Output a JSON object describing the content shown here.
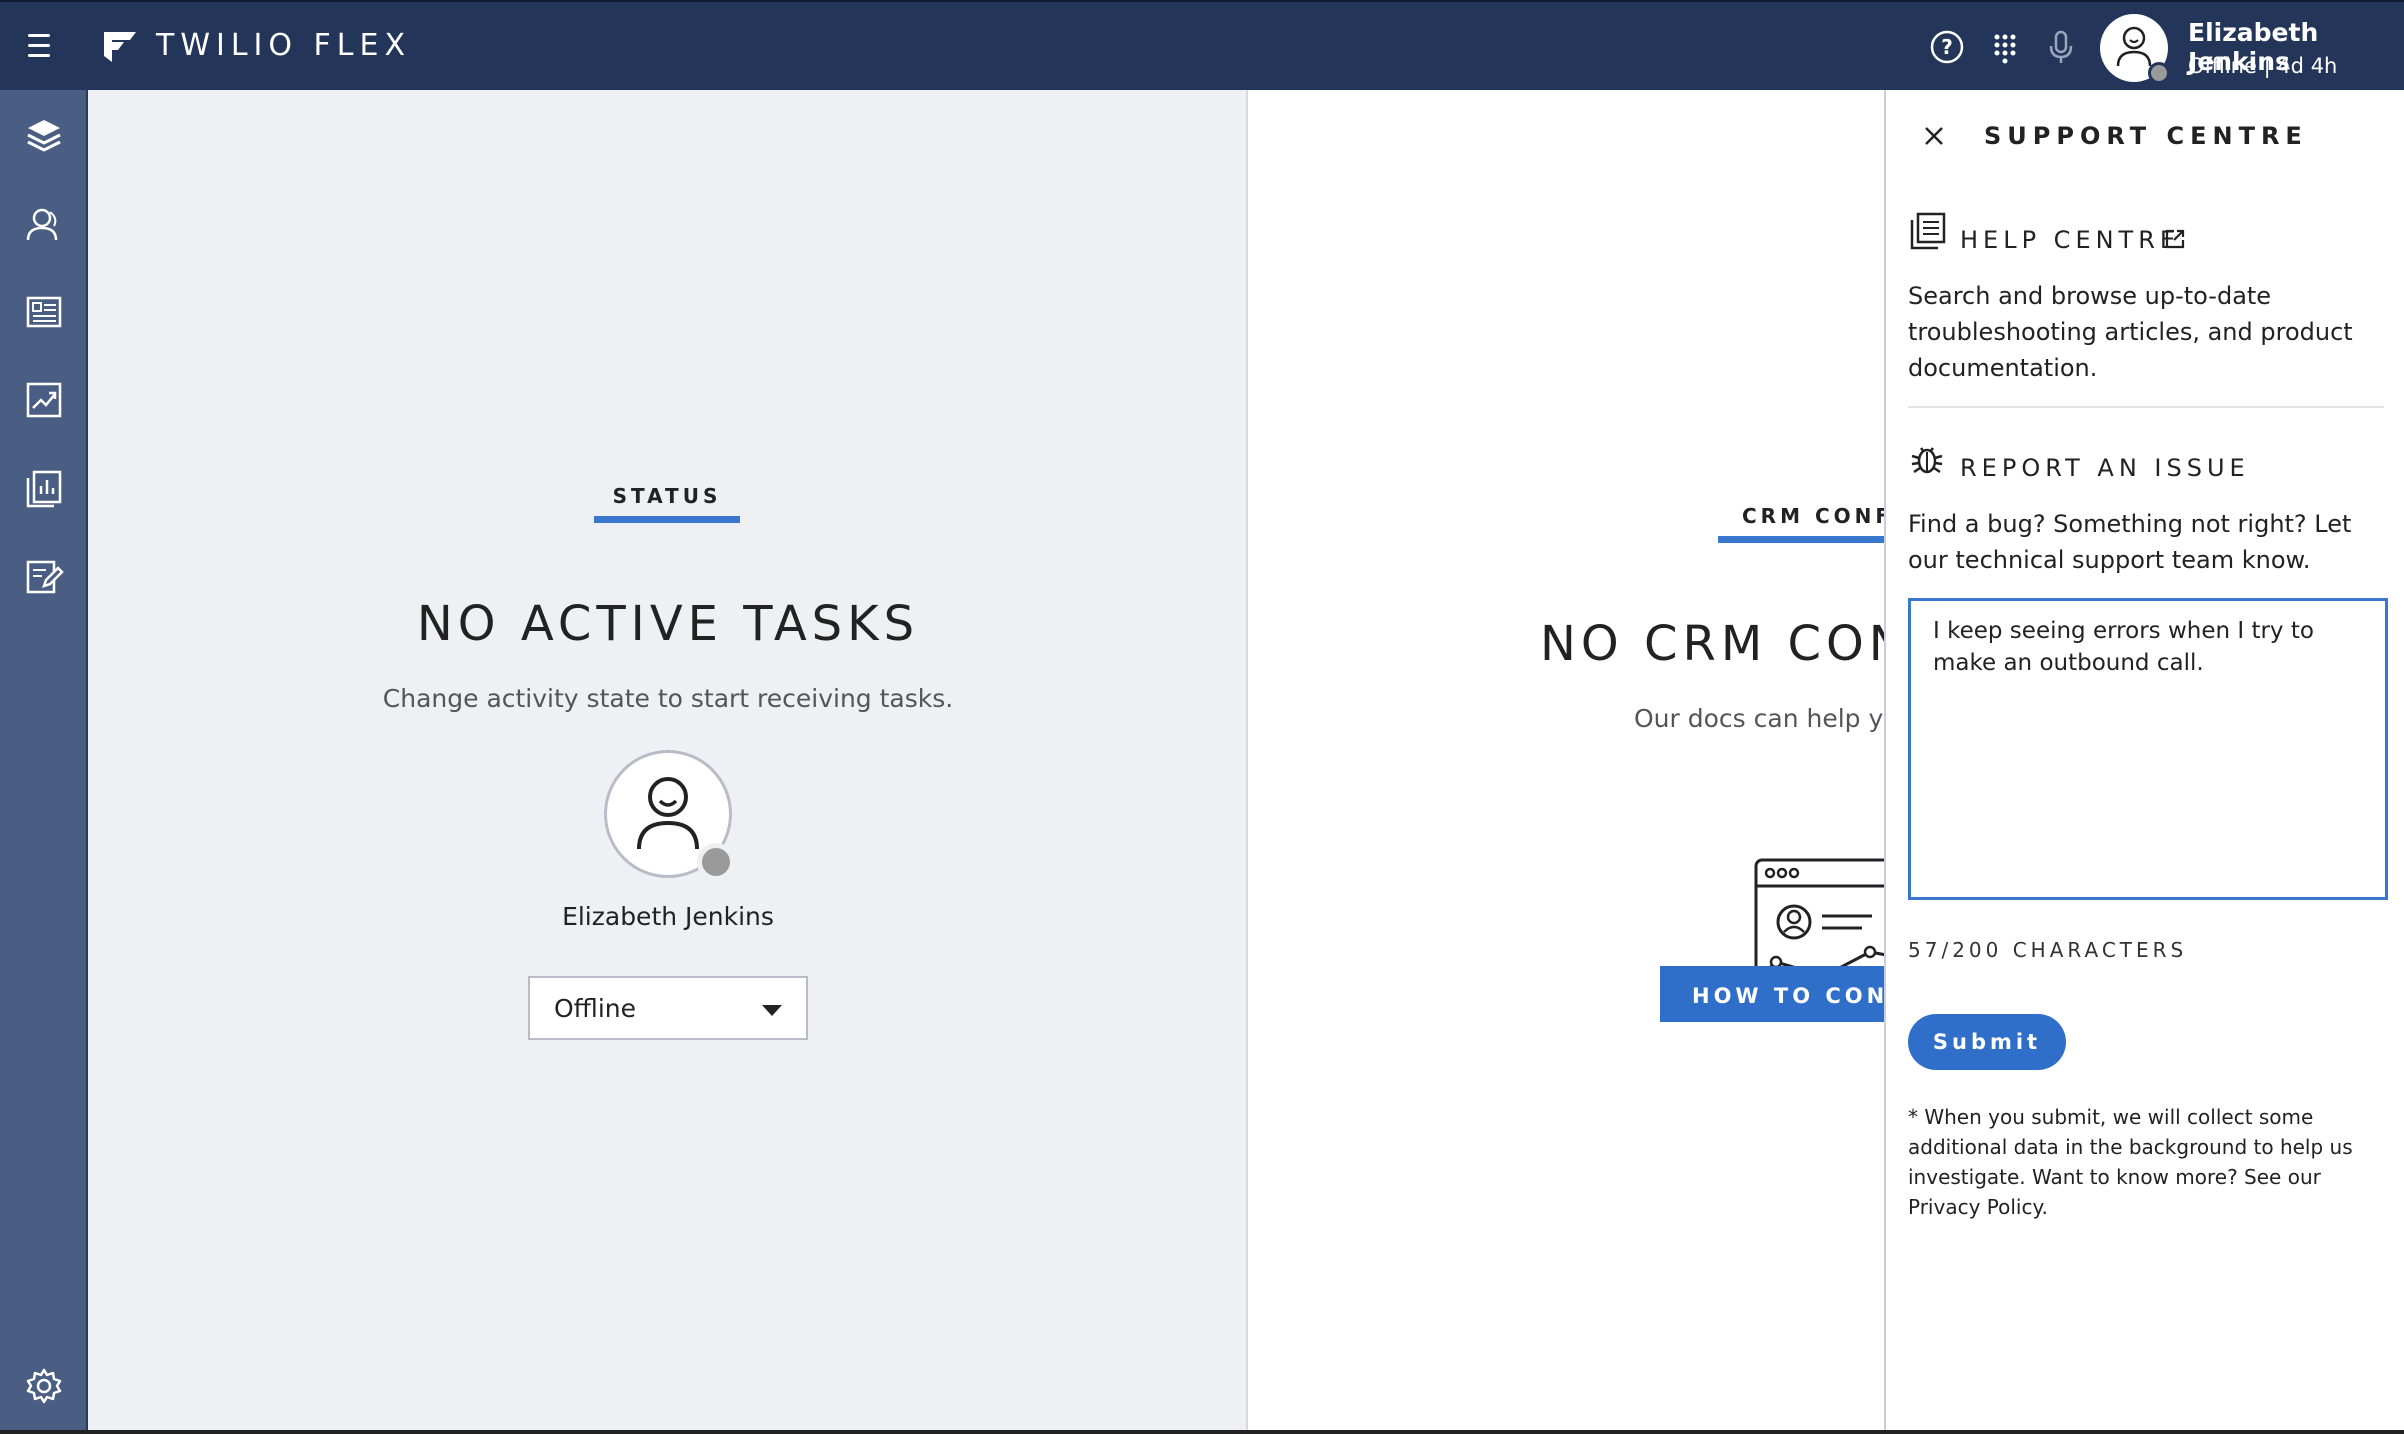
{
  "app": {
    "brand": "TWILIO FLEX"
  },
  "header": {
    "user_name": "Elizabeth Jenkins",
    "user_status": "Offline | 4d 4h",
    "icons": [
      "help-icon",
      "dialpad-icon",
      "microphone-icon"
    ]
  },
  "sidebar": {
    "items": [
      {
        "icon": "layers-icon"
      },
      {
        "icon": "agents-icon"
      },
      {
        "icon": "directory-icon"
      },
      {
        "icon": "analytics-icon"
      },
      {
        "icon": "reports-icon"
      },
      {
        "icon": "edit-icon"
      }
    ],
    "footer_icon": "settings-icon"
  },
  "status_panel": {
    "tab_label": "STATUS",
    "title": "NO ACTIVE TASKS",
    "subtitle": "Change activity state to start receiving tasks.",
    "agent_name": "Elizabeth Jenkins",
    "activity_value": "Offline"
  },
  "crm_panel": {
    "tab_label": "CRM CONFI",
    "title": "NO CRM CON",
    "subtitle": "Our docs can help you",
    "button_label": "HOW TO CONFI"
  },
  "support": {
    "title": "SUPPORT CENTRE",
    "help": {
      "title": "HELP CENTRE",
      "text": "Search and browse up-to-date troubleshooting articles, and product documentation."
    },
    "report": {
      "title": "REPORT AN ISSUE",
      "text": "Find a bug? Something not right? Let our technical support team know.",
      "message": "I keep seeing errors when I try to make an outbound call.",
      "char_count": "57/200 CHARACTERS",
      "submit_label": "Submit",
      "footnote": "* When you submit, we will collect some additional data in the background to help us investigate. Want to know more? See our Privacy Policy."
    }
  },
  "colors": {
    "header_bg": "#233659",
    "sidebar_bg": "#4a5d82",
    "accent": "#3a78cf",
    "button": "#2f6fc9",
    "status_offline": "#9a9a9a"
  }
}
